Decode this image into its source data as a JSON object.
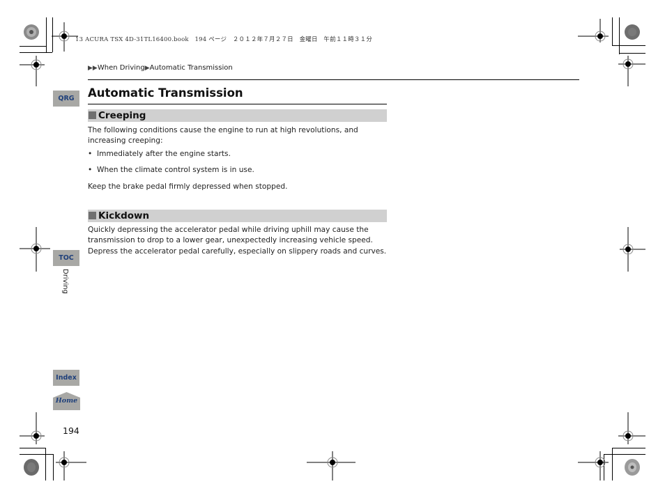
{
  "print_meta": {
    "file": "13 ACURA TSX 4D-31TL16400.book",
    "page_label": "194 ページ",
    "date": "２０１２年７月２７日",
    "weekday": "金曜日",
    "time": "午前１１時３１分"
  },
  "breadcrumb": {
    "arrows": "▶▶",
    "items": [
      "When Driving",
      "Automatic Transmission"
    ],
    "separator": "▶"
  },
  "page_title": "Automatic Transmission",
  "sections": [
    {
      "heading": "Creeping",
      "intro": "The following conditions cause the engine to run at high revolutions, and increasing creeping:",
      "bullets": [
        "Immediately after the engine starts.",
        "When the climate control system is in use."
      ],
      "outro": "Keep the brake pedal firmly depressed when stopped."
    },
    {
      "heading": "Kickdown",
      "body": "Quickly depressing the accelerator pedal while driving uphill may cause the transmission to drop to a lower gear, unexpectedly increasing vehicle speed. Depress the accelerator pedal carefully, especially on slippery roads and curves."
    }
  ],
  "nav": {
    "qrg": "QRG",
    "toc": "TOC",
    "index": "Index",
    "home": "Home",
    "chapter": "Driving"
  },
  "page_number": "194",
  "colors": {
    "nav_tab_bg": "#a8a8a5",
    "nav_tab_text": "#1e3f7a",
    "section_bar": "#d0d0d0",
    "section_square": "#707070"
  }
}
